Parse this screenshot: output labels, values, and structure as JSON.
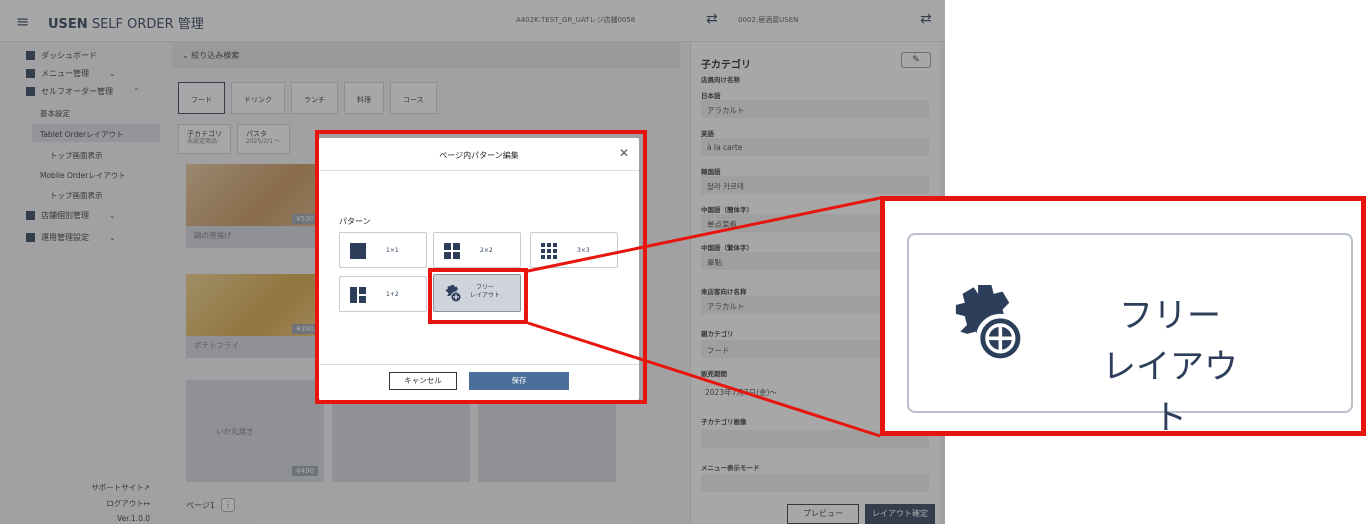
{
  "app": {
    "menu_glyph": "≡",
    "brand_bold": "USEN",
    "brand_rest": " SELF ORDER 管理",
    "store": "A402K:TEST_GR_UATレジ店舗0058",
    "shop": "0002:居酒屋USEN"
  },
  "sidebar": {
    "dashboard": "ダッシュボード",
    "menu_mgmt": "メニュー管理",
    "self_order": "セルフオーダー管理",
    "basic": "基本設定",
    "tablet_layout": "Tablet Orderレイアウト",
    "tablet_top": "トップ画面表示",
    "mobile_layout": "Mobile Orderレイアウト",
    "mobile_top": "トップ画面表示",
    "store_mgmt": "店舗個別管理",
    "ops": "運用管理設定",
    "support": "サポートサイト",
    "logout": "ログアウト",
    "version": "Ver.1.0.0"
  },
  "main": {
    "filter": "絞り込み検索",
    "cat_tabs": [
      "フード",
      "ドリンク",
      "ランチ",
      "料理",
      "コース"
    ],
    "sub_tabs": [
      {
        "title": "子カテゴリ",
        "sub": "未設定商品"
      },
      {
        "title": "パスタ",
        "sub": "2025/2/1 〜"
      }
    ],
    "items": [
      {
        "name": "鶏の唐揚げ",
        "price": "¥530"
      },
      {
        "name": "ポテトフライ",
        "price": "¥390"
      },
      {
        "name": "いか丸焼き",
        "price": "¥490"
      }
    ],
    "page": "ページ1"
  },
  "right_panel": {
    "title": "子カテゴリ",
    "store_name_label": "店員向け名称",
    "ja_label": "日本語",
    "ja": "アラカルト",
    "en_label": "英語",
    "en": "à la carte",
    "ko_label": "韓国語",
    "ko": "알라 카르테",
    "zh_s_label": "中国語（簡体字）",
    "zh_s": "单点菜肴",
    "zh_t_label": "中国語（繁体字）",
    "zh_t": "單點",
    "guest_label": "来店客向け名称",
    "guest": "アラカルト",
    "parent_label": "親カテゴリ",
    "parent": "フード",
    "period_label": "販売期間",
    "period": "2023年7月7日(金)〜",
    "image_label": "子カテゴリ画像",
    "mode_label": "メニュー表示モード",
    "preview": "プレビュー",
    "confirm": "レイアウト確定"
  },
  "modal": {
    "title": "ページ内パターン編集",
    "pattern_label": "パターン",
    "patterns": [
      "1×1",
      "2×2",
      "3×3",
      "1+2",
      "フリーレイアウト"
    ],
    "free_line1": "フリー",
    "free_line2": "レイアウト",
    "cancel": "キャンセル",
    "save": "保存"
  },
  "zoom": {
    "line1": "フリー",
    "line2": "レイアウト"
  },
  "colors": {
    "accent": "#2c3e5a",
    "highlight": "#e8140e",
    "save": "#4a6f9a"
  }
}
